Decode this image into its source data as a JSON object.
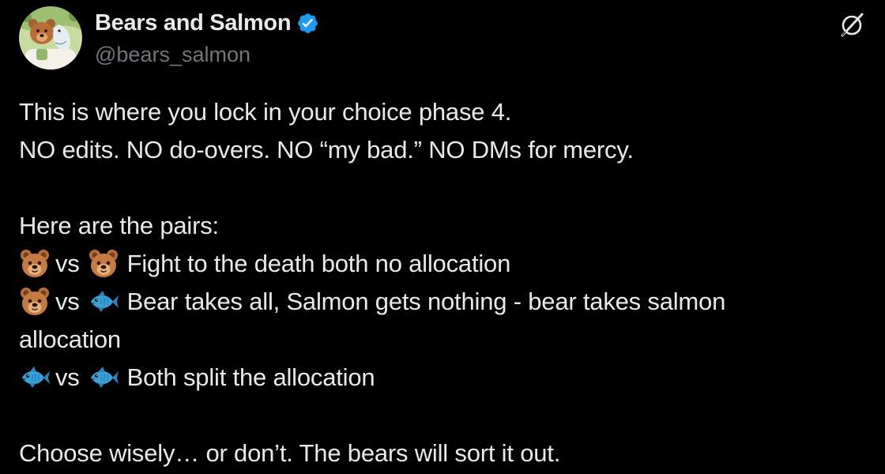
{
  "author": {
    "display_name": "Bears and Salmon",
    "handle": "@bears_salmon",
    "verified": true,
    "verified_color": "#1d9bf0",
    "avatar_icon": "bear-and-salmon-avatar-icon"
  },
  "actions": {
    "grok_icon": "grok-icon"
  },
  "tweet": {
    "line1": "This is where you lock in your choice phase 4.",
    "line2": "NO edits. NO do-overs. NO “my bad.” NO DMs for mercy.",
    "line3": "Here are the pairs:",
    "pairs": [
      {
        "left_emoji": "bear-face",
        "vs": "vs",
        "right_emoji": "bear-face",
        "text": "Fight to the death both no allocation"
      },
      {
        "left_emoji": "bear-face",
        "vs": "vs",
        "right_emoji": "fish",
        "text": "Bear takes all, Salmon gets nothing - bear takes salmon",
        "text_cont": "allocation"
      },
      {
        "left_emoji": "fish",
        "vs": "vs",
        "right_emoji": "fish",
        "text": "Both split the allocation"
      }
    ],
    "closing": "Choose wisely… or don’t. The bears will sort it out."
  },
  "colors": {
    "background": "#000000",
    "text": "#e7e9ea",
    "muted": "#71767b"
  }
}
